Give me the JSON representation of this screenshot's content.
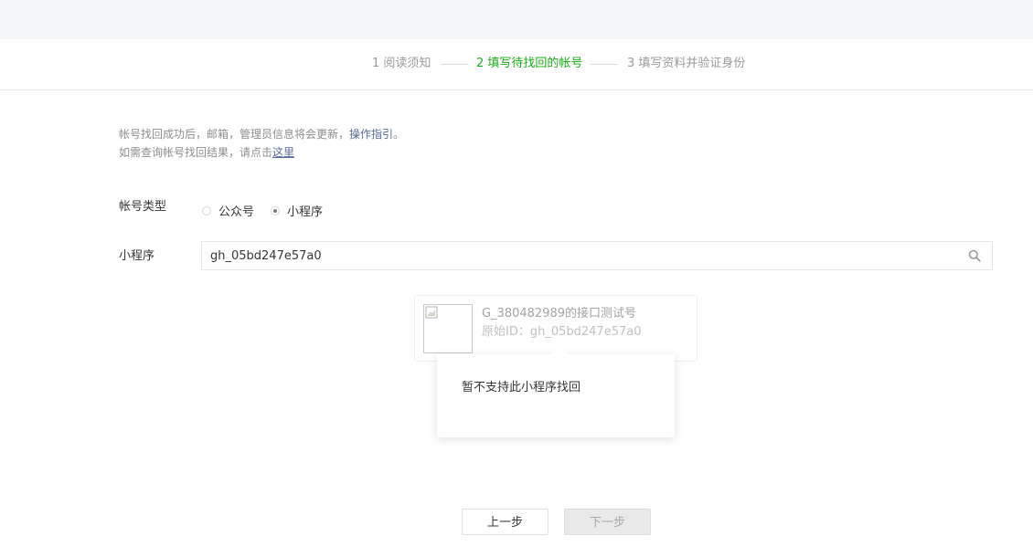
{
  "steps": [
    {
      "label": "1 阅读须知",
      "active": false
    },
    {
      "label": "2 填写待找回的帐号",
      "active": true
    },
    {
      "label": "3 填写资料并验证身份",
      "active": false
    }
  ],
  "notice": {
    "line1_prefix": "帐号找回成功后，邮箱，管理员信息将会更新，",
    "line1_link": "操作指引",
    "line1_suffix": "。",
    "line2_prefix": "如需查询帐号找回结果，请点击",
    "line2_link": "这里"
  },
  "account_type": {
    "label": "帐号类型",
    "options": [
      {
        "label": "公众号",
        "checked": false
      },
      {
        "label": "小程序",
        "checked": true
      }
    ]
  },
  "search": {
    "label": "小程序",
    "value": "gh_05bd247e57a0",
    "icon": "search-icon"
  },
  "result": {
    "name": "G_380482989的接口测试号",
    "id_text": "原始ID：gh_05bd247e57a0"
  },
  "tooltip": {
    "message": "暂不支持此小程序找回"
  },
  "buttons": {
    "prev": "上一步",
    "next": "下一步"
  },
  "colors": {
    "accent": "#1aad19",
    "link": "#576b95"
  }
}
